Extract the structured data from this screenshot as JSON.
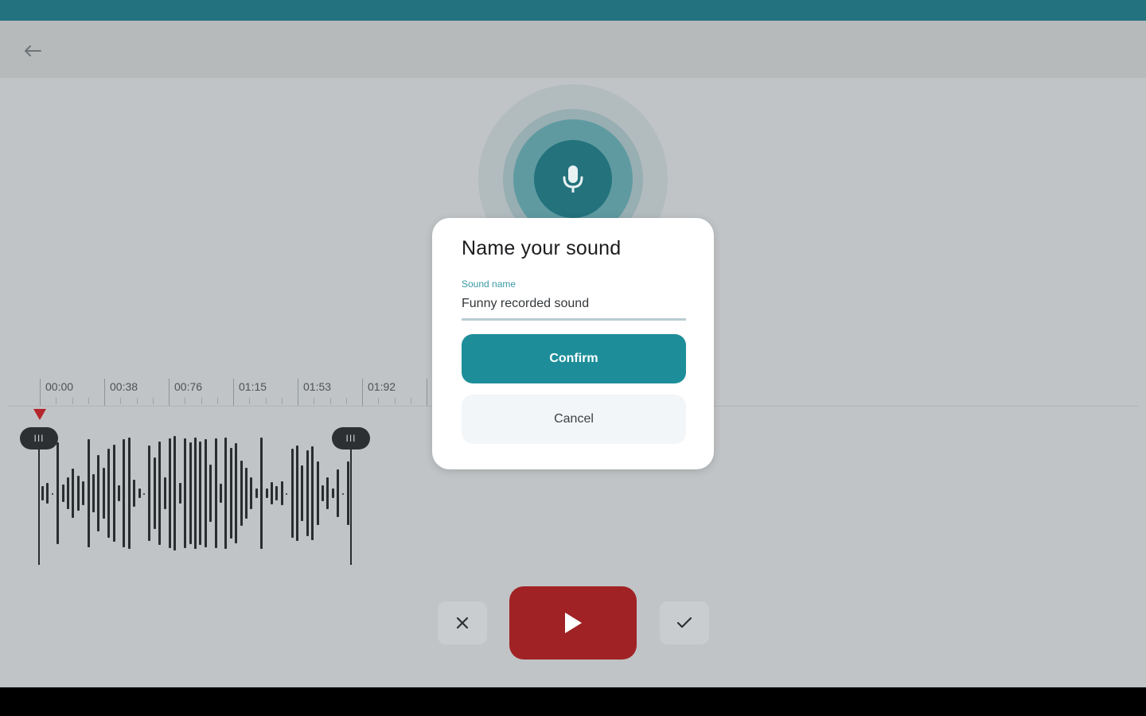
{
  "colors": {
    "status_bar": "#22727f",
    "accent": "#1d8e99",
    "mic": "#23727c",
    "record_red": "#a02225",
    "background": "#c1c4c6"
  },
  "header": {
    "back_icon": "arrow-left-icon"
  },
  "recorder": {
    "mic_icon": "microphone-icon"
  },
  "timeline": {
    "ticks": [
      "00:00",
      "00:38",
      "00:76",
      "01:15",
      "01:53",
      "01:92"
    ]
  },
  "trim": {
    "start_handle_glyph": "III",
    "end_handle_glyph": "III"
  },
  "controls": {
    "discard_icon": "close-icon",
    "play_icon": "play-icon",
    "accept_icon": "check-icon"
  },
  "dialog": {
    "title": "Name your sound",
    "field_label": "Sound name",
    "field_value": "Funny recorded sound",
    "confirm_label": "Confirm",
    "cancel_label": "Cancel"
  }
}
